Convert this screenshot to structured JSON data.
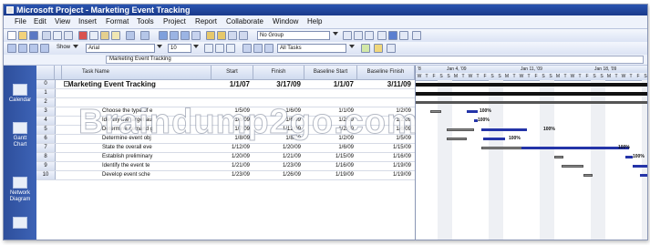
{
  "window": {
    "title": "Microsoft Project - Marketing Event Tracking"
  },
  "menu": [
    "File",
    "Edit",
    "View",
    "Insert",
    "Format",
    "Tools",
    "Project",
    "Report",
    "Collaborate",
    "Window",
    "Help"
  ],
  "toolbar": {
    "group_value": "No Group",
    "show_label": "Show",
    "font_name": "Arial",
    "font_size": "10",
    "filter_value": "All Tasks"
  },
  "entry_bar": {
    "value": "Marketing Event Tracking"
  },
  "view_bar": [
    {
      "label": "Calendar",
      "icon": "calendar-icon"
    },
    {
      "label": "Gantt Chart",
      "icon": "gantt-icon"
    },
    {
      "label": "Network Diagram",
      "icon": "network-icon"
    },
    {
      "label": "",
      "icon": "task-usage-icon"
    }
  ],
  "grid": {
    "columns": [
      "Task Name",
      "Start",
      "Finish",
      "Baseline Start",
      "Baseline Finish"
    ],
    "rows": [
      {
        "id": "0",
        "name": "Marketing Event Tracking",
        "start": "1/1/07",
        "finish": "3/17/09",
        "bstart": "1/1/07",
        "bfinish": "3/11/09",
        "summary": true
      },
      {
        "id": "1",
        "name": "",
        "start": "",
        "finish": "",
        "bstart": "",
        "bfinish": ""
      },
      {
        "id": "2",
        "name": "",
        "start": "",
        "finish": "",
        "bstart": "",
        "bfinish": ""
      },
      {
        "id": "3",
        "name": "Choose the type of e",
        "start": "1/5/09",
        "finish": "1/6/09",
        "bstart": "1/1/09",
        "bfinish": "1/2/09"
      },
      {
        "id": "4",
        "name": "Identify the target au",
        "start": "1/6/09",
        "finish": "1/6/09",
        "bstart": "1/2/09",
        "bfinish": "1/2/09"
      },
      {
        "id": "5",
        "name": "Determine demand g",
        "start": "1/7/09",
        "finish": "1/12/09",
        "bstart": "1/2/09",
        "bfinish": "1/6/09"
      },
      {
        "id": "6",
        "name": "Determine event obj",
        "start": "1/8/09",
        "finish": "1/8/09",
        "bstart": "1/2/09",
        "bfinish": "1/5/09"
      },
      {
        "id": "7",
        "name": "State the overall eve",
        "start": "1/12/09",
        "finish": "1/20/09",
        "bstart": "1/6/09",
        "bfinish": "1/15/09"
      },
      {
        "id": "8",
        "name": "Establish preliminary",
        "start": "1/20/09",
        "finish": "1/21/09",
        "bstart": "1/15/09",
        "bfinish": "1/16/09"
      },
      {
        "id": "9",
        "name": "Identify the event te",
        "start": "1/21/09",
        "finish": "1/23/09",
        "bstart": "1/16/09",
        "bfinish": "1/19/09"
      },
      {
        "id": "10",
        "name": "Develop event sche",
        "start": "1/23/09",
        "finish": "1/26/09",
        "bstart": "1/19/09",
        "bfinish": "1/19/09"
      }
    ]
  },
  "timescale": {
    "weeks": [
      "Jan 4, '09",
      "Jan 11, '09",
      "Jan 18, '09"
    ],
    "days": [
      "W",
      "T",
      "F",
      "S",
      "S",
      "M",
      "T",
      "W",
      "T",
      "F",
      "S",
      "S",
      "M",
      "T",
      "W",
      "T",
      "F",
      "S",
      "S",
      "M",
      "T",
      "W",
      "T",
      "F",
      "S",
      "S",
      "M",
      "T",
      "W",
      "T",
      "F",
      "S"
    ],
    "first_week_prefix": "'8"
  },
  "gantt_labels": {
    "r3": "100%",
    "r4": "100%",
    "r5": "100%",
    "r6": "100%",
    "r9": "100%",
    "r10": "100%"
  },
  "watermark": "Braindump2go.com"
}
